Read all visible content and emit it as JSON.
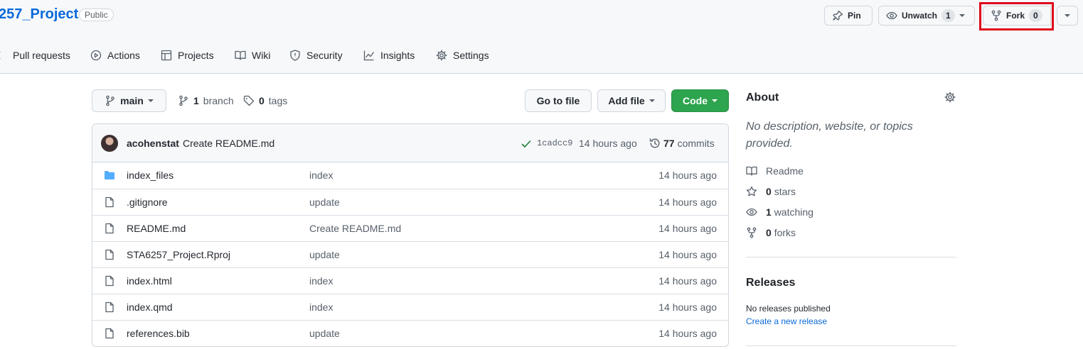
{
  "repo": {
    "name": "257_Project",
    "visibility": "Public"
  },
  "header_buttons": {
    "pin": "Pin",
    "unwatch": "Unwatch",
    "unwatch_count": "1",
    "fork": "Fork",
    "fork_count": "0"
  },
  "nav": {
    "items": [
      {
        "label": "Pull requests",
        "icon": "git-pull-request-icon"
      },
      {
        "label": "Actions",
        "icon": "play-icon"
      },
      {
        "label": "Projects",
        "icon": "table-icon"
      },
      {
        "label": "Wiki",
        "icon": "book-icon"
      },
      {
        "label": "Security",
        "icon": "shield-icon"
      },
      {
        "label": "Insights",
        "icon": "graph-icon"
      },
      {
        "label": "Settings",
        "icon": "gear-icon"
      }
    ]
  },
  "toolbar": {
    "branch": "main",
    "branch_count": "1",
    "branch_label": "branch",
    "tag_count": "0",
    "tag_label": "tags",
    "go_to_file": "Go to file",
    "add_file": "Add file",
    "code": "Code"
  },
  "latest_commit": {
    "author": "acohenstat",
    "message": "Create README.md",
    "sha": "1cadcc9",
    "time": "14 hours ago",
    "commit_count": "77",
    "commits_label": "commits"
  },
  "files": [
    {
      "name": "index_files",
      "type": "folder",
      "message": "index",
      "time": "14 hours ago"
    },
    {
      "name": ".gitignore",
      "type": "file",
      "message": "update",
      "time": "14 hours ago"
    },
    {
      "name": "README.md",
      "type": "file",
      "message": "Create README.md",
      "time": "14 hours ago"
    },
    {
      "name": "STA6257_Project.Rproj",
      "type": "file",
      "message": "update",
      "time": "14 hours ago"
    },
    {
      "name": "index.html",
      "type": "file",
      "message": "index",
      "time": "14 hours ago"
    },
    {
      "name": "index.qmd",
      "type": "file",
      "message": "index",
      "time": "14 hours ago"
    },
    {
      "name": "references.bib",
      "type": "file",
      "message": "update",
      "time": "14 hours ago"
    }
  ],
  "about": {
    "title": "About",
    "description": "No description, website, or topics provided.",
    "readme": "Readme",
    "stars_count": "0",
    "stars_label": "stars",
    "watching_count": "1",
    "watching_label": "watching",
    "forks_count": "0",
    "forks_label": "forks"
  },
  "releases": {
    "title": "Releases",
    "none": "No releases published",
    "create": "Create a new release"
  },
  "colors": {
    "link": "#0969da",
    "code_button": "#2da44e",
    "highlight": "#e0061c"
  }
}
